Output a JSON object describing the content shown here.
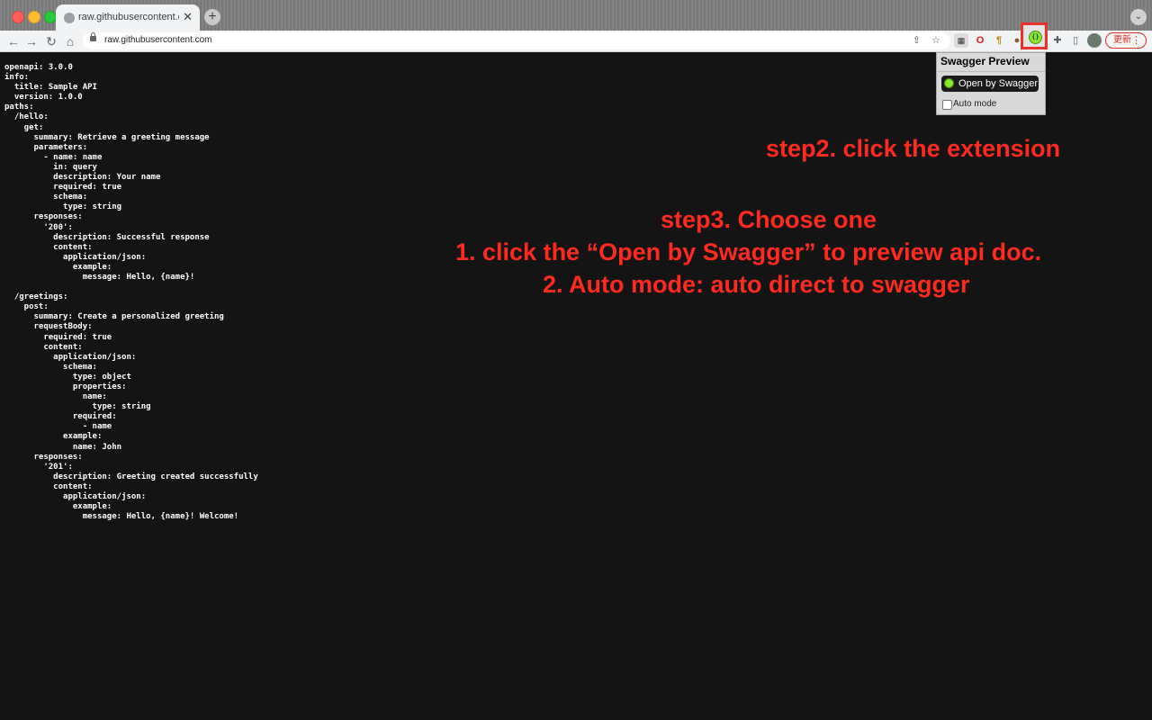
{
  "browser": {
    "tab": {
      "title": "raw.githubusercontent.com/ha"
    },
    "new_tab": "+",
    "tab_search": "⌄",
    "nav": {
      "back": "←",
      "forward": "→",
      "reload": "↻",
      "home": "⌂"
    },
    "url": "raw.githubusercontent.com",
    "update_label": "更新",
    "extensions": [
      "qr-code-icon",
      "opera-icon",
      "paragraph-icon",
      "dog-icon",
      "swagger-icon",
      "puzzle-icon",
      "side-panel-icon",
      "avatar"
    ]
  },
  "yaml_lines": [
    "openapi: 3.0.0",
    "info:",
    "  title: Sample API",
    "  version: 1.0.0",
    "paths:",
    "  /hello:",
    "    get:",
    "      summary: Retrieve a greeting message",
    "      parameters:",
    "        - name: name",
    "          in: query",
    "          description: Your name",
    "          required: true",
    "          schema:",
    "            type: string",
    "      responses:",
    "        '200':",
    "          description: Successful response",
    "          content:",
    "            application/json:",
    "              example:",
    "                message: Hello, {name}!",
    "",
    "  /greetings:",
    "    post:",
    "      summary: Create a personalized greeting",
    "      requestBody:",
    "        required: true",
    "        content:",
    "          application/json:",
    "            schema:",
    "              type: object",
    "              properties:",
    "                name:",
    "                  type: string",
    "              required:",
    "                - name",
    "            example:",
    "              name: John",
    "      responses:",
    "        '201':",
    "          description: Greeting created successfully",
    "          content:",
    "            application/json:",
    "              example:",
    "                message: Hello, {name}! Welcome!"
  ],
  "popup": {
    "title": "Swagger Preview",
    "open_button": "Open by Swagger",
    "auto_mode_label": "Auto mode",
    "auto_mode_checked": false
  },
  "annotations": {
    "step2": "step2. click the extension",
    "step3_title": "step3. Choose one",
    "step3_option1": "1. click the “Open by Swagger” to preview api doc.",
    "step3_option2": "2. Auto mode: auto direct to swagger",
    "color": "#ff2a1f"
  }
}
